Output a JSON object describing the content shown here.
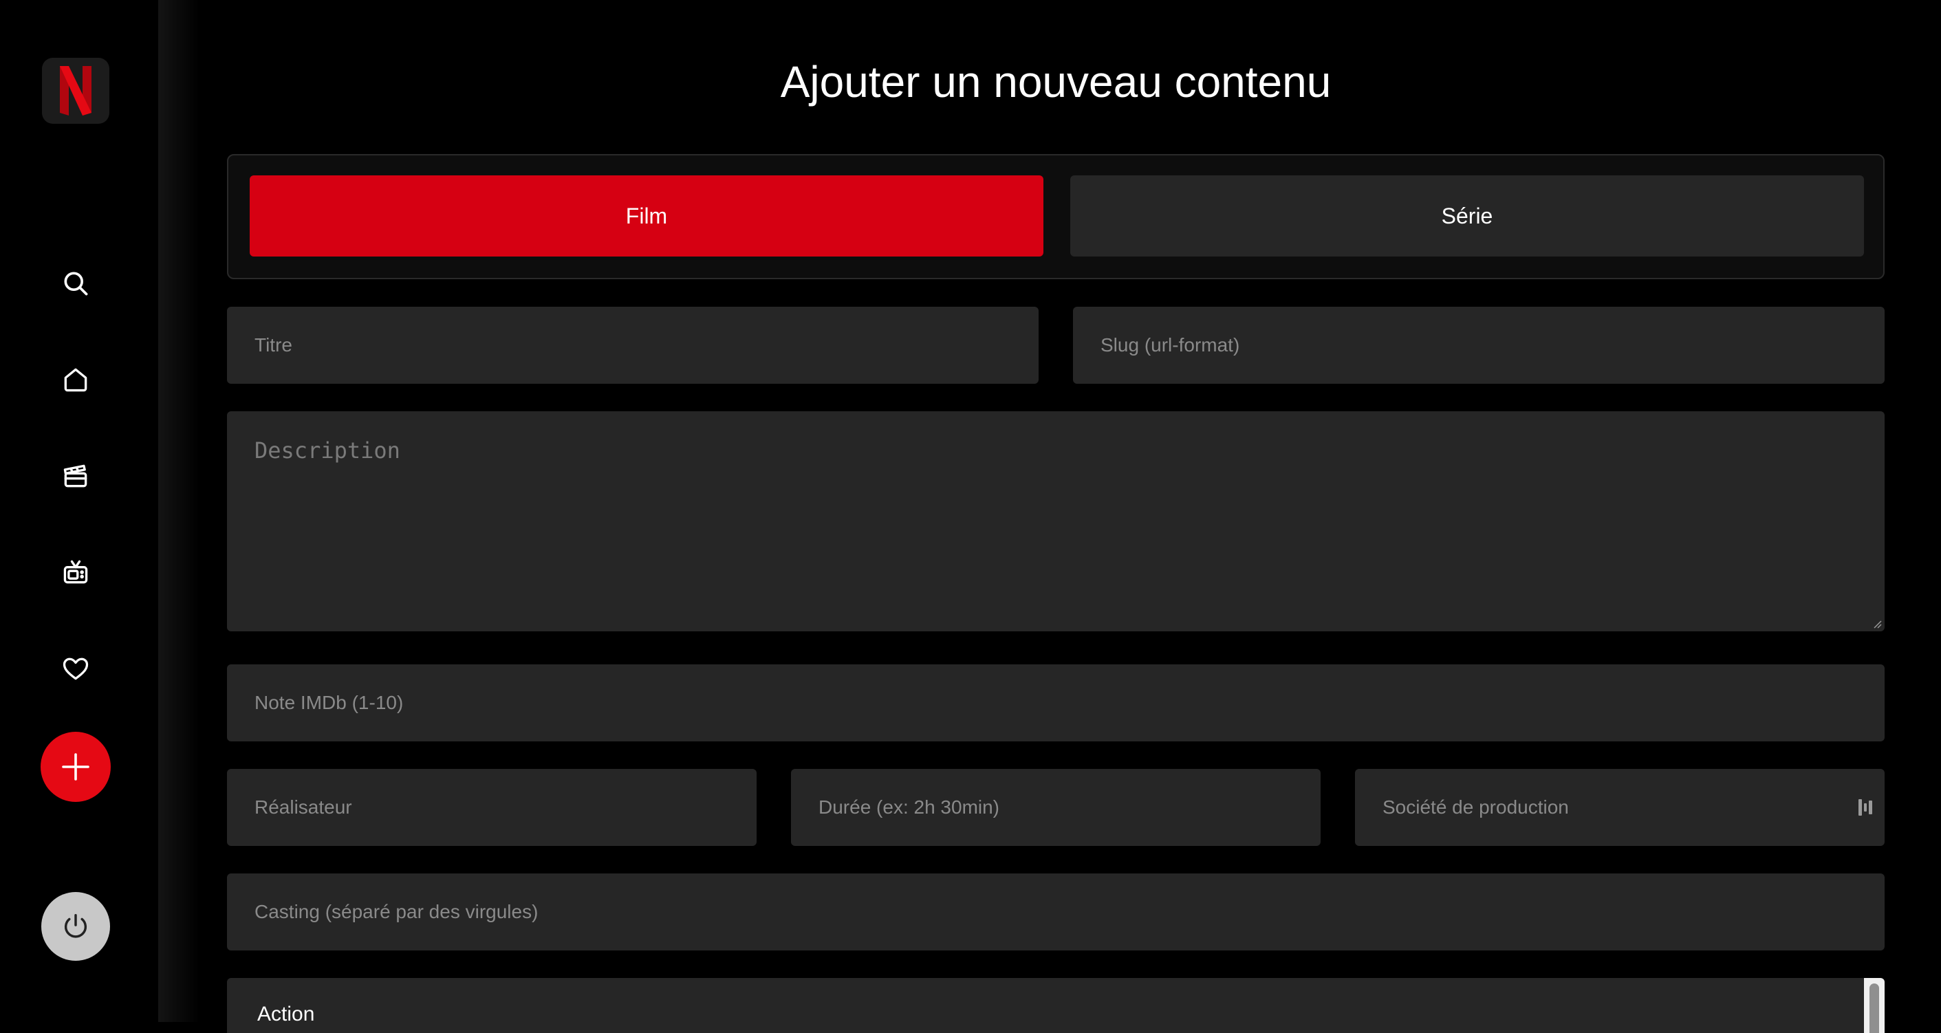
{
  "sidebar": {
    "logo_letter": "N",
    "nav": [
      {
        "name": "search",
        "icon": "search-icon"
      },
      {
        "name": "home",
        "icon": "home-icon"
      },
      {
        "name": "movies",
        "icon": "clapperboard-icon"
      },
      {
        "name": "series",
        "icon": "tv-icon"
      },
      {
        "name": "favorites",
        "icon": "heart-icon"
      }
    ],
    "add_icon": "plus-icon",
    "logout_icon": "power-icon"
  },
  "header": {
    "title": "Ajouter un nouveau contenu"
  },
  "type_toggle": {
    "film_label": "Film",
    "serie_label": "Série",
    "selected": "Film"
  },
  "form": {
    "title_placeholder": "Titre",
    "slug_placeholder": "Slug (url-format)",
    "description_placeholder": "Description",
    "imdb_placeholder": "Note IMDb (1-10)",
    "director_placeholder": "Réalisateur",
    "duration_placeholder": "Durée (ex: 2h 30min)",
    "production_placeholder": "Société de production",
    "cast_placeholder": "Casting (séparé par des virgules)",
    "genres": [
      "Action"
    ]
  },
  "colors": {
    "accent": "#e50914",
    "selected_toggle": "#d60012",
    "field_bg": "#262626",
    "background": "#000000"
  }
}
